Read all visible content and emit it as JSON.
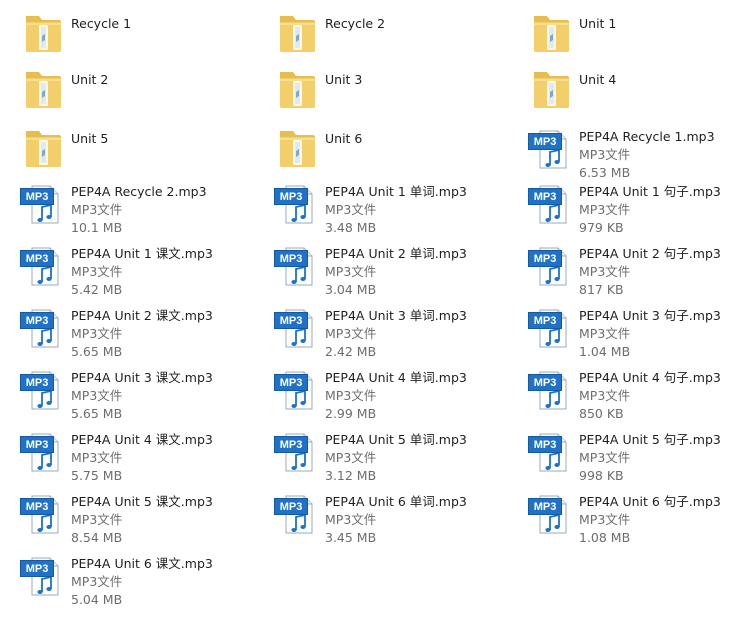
{
  "window": {
    "view": "tiles",
    "accent": "#1f72c8",
    "folder_color": "#f3cf6b"
  },
  "items": [
    {
      "name": "Recycle 1",
      "kind": "folder"
    },
    {
      "name": "Recycle 2",
      "kind": "folder"
    },
    {
      "name": "Unit 1",
      "kind": "folder"
    },
    {
      "name": "Unit 2",
      "kind": "folder"
    },
    {
      "name": "Unit 3",
      "kind": "folder"
    },
    {
      "name": "Unit 4",
      "kind": "folder"
    },
    {
      "name": "Unit 5",
      "kind": "folder"
    },
    {
      "name": "Unit 6",
      "kind": "folder"
    },
    {
      "name": "PEP4A Recycle 1.mp3",
      "kind": "mp3",
      "icon_label": "MP3",
      "type": "MP3文件",
      "size": "6.53 MB"
    },
    {
      "name": "PEP4A Recycle 2.mp3",
      "kind": "mp3",
      "icon_label": "MP3",
      "type": "MP3文件",
      "size": "10.1 MB"
    },
    {
      "name": "PEP4A Unit 1 单词.mp3",
      "kind": "mp3",
      "icon_label": "MP3",
      "type": "MP3文件",
      "size": "3.48 MB"
    },
    {
      "name": "PEP4A Unit 1 句子.mp3",
      "kind": "mp3",
      "icon_label": "MP3",
      "type": "MP3文件",
      "size": "979 KB"
    },
    {
      "name": "PEP4A Unit 1 课文.mp3",
      "kind": "mp3",
      "icon_label": "MP3",
      "type": "MP3文件",
      "size": "5.42 MB"
    },
    {
      "name": "PEP4A Unit 2 单词.mp3",
      "kind": "mp3",
      "icon_label": "MP3",
      "type": "MP3文件",
      "size": "3.04 MB"
    },
    {
      "name": "PEP4A Unit 2 句子.mp3",
      "kind": "mp3",
      "icon_label": "MP3",
      "type": "MP3文件",
      "size": "817 KB"
    },
    {
      "name": "PEP4A Unit 2 课文.mp3",
      "kind": "mp3",
      "icon_label": "MP3",
      "type": "MP3文件",
      "size": "5.65 MB"
    },
    {
      "name": "PEP4A Unit 3 单词.mp3",
      "kind": "mp3",
      "icon_label": "MP3",
      "type": "MP3文件",
      "size": "2.42 MB"
    },
    {
      "name": "PEP4A Unit 3 句子.mp3",
      "kind": "mp3",
      "icon_label": "MP3",
      "type": "MP3文件",
      "size": "1.04 MB"
    },
    {
      "name": "PEP4A Unit 3 课文.mp3",
      "kind": "mp3",
      "icon_label": "MP3",
      "type": "MP3文件",
      "size": "5.65 MB"
    },
    {
      "name": "PEP4A Unit 4 单词.mp3",
      "kind": "mp3",
      "icon_label": "MP3",
      "type": "MP3文件",
      "size": "2.99 MB"
    },
    {
      "name": "PEP4A Unit 4 句子.mp3",
      "kind": "mp3",
      "icon_label": "MP3",
      "type": "MP3文件",
      "size": "850 KB"
    },
    {
      "name": "PEP4A Unit 4 课文.mp3",
      "kind": "mp3",
      "icon_label": "MP3",
      "type": "MP3文件",
      "size": "5.75 MB"
    },
    {
      "name": "PEP4A Unit 5 单词.mp3",
      "kind": "mp3",
      "icon_label": "MP3",
      "type": "MP3文件",
      "size": "3.12 MB"
    },
    {
      "name": "PEP4A Unit 5 句子.mp3",
      "kind": "mp3",
      "icon_label": "MP3",
      "type": "MP3文件",
      "size": "998 KB"
    },
    {
      "name": "PEP4A Unit 5 课文.mp3",
      "kind": "mp3",
      "icon_label": "MP3",
      "type": "MP3文件",
      "size": "8.54 MB"
    },
    {
      "name": "PEP4A Unit 6 单词.mp3",
      "kind": "mp3",
      "icon_label": "MP3",
      "type": "MP3文件",
      "size": "3.45 MB"
    },
    {
      "name": "PEP4A Unit 6 句子.mp3",
      "kind": "mp3",
      "icon_label": "MP3",
      "type": "MP3文件",
      "size": "1.08 MB"
    },
    {
      "name": "PEP4A Unit 6 课文.mp3",
      "kind": "mp3",
      "icon_label": "MP3",
      "type": "MP3文件",
      "size": "5.04 MB"
    }
  ]
}
